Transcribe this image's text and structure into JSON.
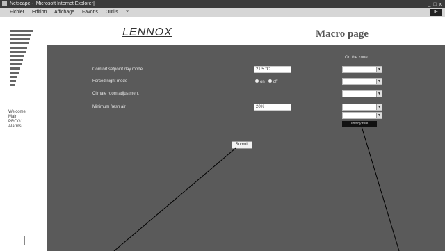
{
  "window": {
    "title": "Netscape - [Microsoft Internet Explorer]",
    "buttons": "_ □ x"
  },
  "menu": {
    "items": [
      "Fichier",
      "Edition",
      "Affichage",
      "Favoris",
      "Outils",
      "?"
    ],
    "logo": "IE"
  },
  "sidebar": {
    "links": [
      "Welcome",
      "Main",
      "PROG1",
      "Alarms"
    ]
  },
  "header": {
    "logo": "LENNOX",
    "title": "Macro page"
  },
  "main": {
    "column_header": "On the zone",
    "rows": [
      {
        "label": "Comfort setpoint day mode",
        "value": "21.5 °C"
      },
      {
        "label": "Forced night mode",
        "radio_on": "on",
        "radio_off": "off"
      },
      {
        "label": "Climate room adjustment"
      },
      {
        "label": "Minimum fresh air",
        "value": "20%"
      }
    ],
    "black_label": "unit by rule",
    "submit_label": "Submit"
  }
}
